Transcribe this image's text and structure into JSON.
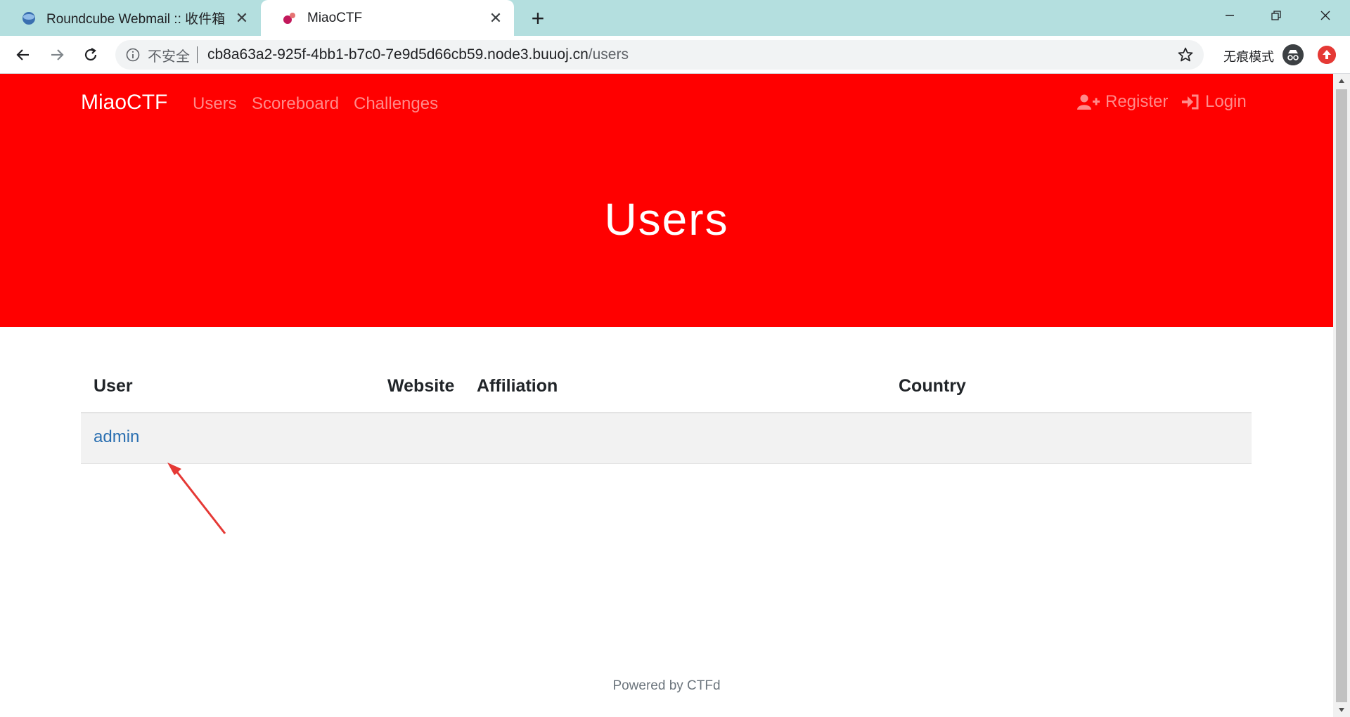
{
  "browser": {
    "tabs": [
      {
        "title": "Roundcube Webmail :: 收件箱",
        "active": false
      },
      {
        "title": "MiaoCTF",
        "active": true
      }
    ],
    "omnibox": {
      "security_label": "不安全",
      "url_host": "cb8a63a2-925f-4bb1-b7c0-7e9d5d66cb59.node3.buuoj.cn",
      "url_path": "/users"
    },
    "incognito_label": "无痕模式"
  },
  "navbar": {
    "brand": "MiaoCTF",
    "links": [
      "Users",
      "Scoreboard",
      "Challenges"
    ],
    "register": "Register",
    "login": "Login"
  },
  "page": {
    "title": "Users",
    "table": {
      "headers": [
        "User",
        "Website",
        "Affiliation",
        "Country"
      ],
      "rows": [
        {
          "user": "admin",
          "website": "",
          "affiliation": "",
          "country": ""
        }
      ]
    },
    "footer": "Powered by CTFd"
  },
  "colors": {
    "theme": "#ff0000",
    "nav_link": "#ff8a8a",
    "user_link": "#2a6fb1",
    "annotation_arrow": "#e53935"
  }
}
